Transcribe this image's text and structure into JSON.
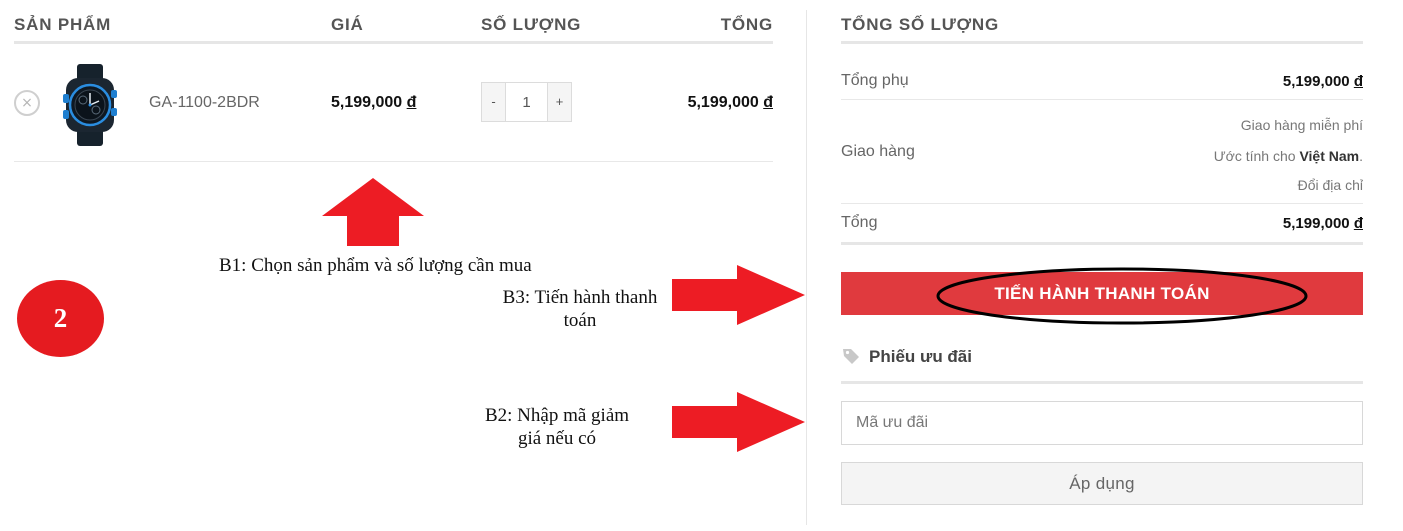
{
  "cart": {
    "headers": {
      "product": "SẢN PHẨM",
      "price": "GIÁ",
      "quantity": "SỐ LƯỢNG",
      "total": "TỔNG"
    },
    "items": [
      {
        "remove_icon": "×",
        "name": "GA-1100-2BDR",
        "price": "5,199,000",
        "quantity": "1",
        "subtotal": "5,199,000"
      }
    ],
    "currency_symbol": "đ",
    "qty_minus": "-",
    "qty_plus": "+"
  },
  "annotations": {
    "b1": "B1: Chọn sản phẩm và số lượng cần mua",
    "b2": "B2: Nhập mã giảm giá nếu có",
    "b3": "B3: Tiến hành thanh toán",
    "step_badge": "2",
    "arrow_color": "#ed1c24"
  },
  "totals": {
    "title": "TỔNG SỐ LƯỢNG",
    "subtotal_label": "Tổng phụ",
    "subtotal_value": "5,199,000",
    "shipping_label": "Giao hàng",
    "shipping_free": "Giao hàng miễn phí",
    "shipping_estimate_prefix": "Ước tính cho",
    "shipping_country": "Việt Nam",
    "shipping_estimate_suffix": ".",
    "change_address": "Đổi địa chỉ",
    "total_label": "Tổng",
    "total_value": "5,199,000",
    "checkout_button": "TIẾN HÀNH THANH TOÁN",
    "checkout_color": "#e03a3e"
  },
  "coupon": {
    "title": "Phiếu ưu đãi",
    "icon": "tag-icon",
    "placeholder": "Mã ưu đãi",
    "apply_button": "Áp dụng"
  }
}
